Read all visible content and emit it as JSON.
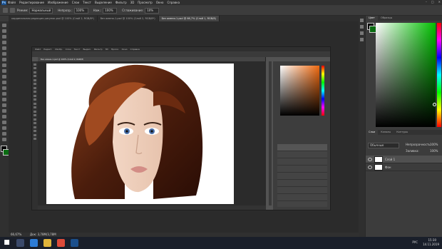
{
  "app": {
    "logo": "Ps",
    "menus": [
      "Файл",
      "Редактирование",
      "Изображение",
      "Слои",
      "Текст",
      "Выделение",
      "Фильтр",
      "3D",
      "Просмотр",
      "Окно",
      "Справка"
    ]
  },
  "options": {
    "mode_label": "Режим:",
    "mode_value": "Нормальный",
    "opacity_label": "Непрозр.:",
    "opacity_value": "100%",
    "push_label": "Наж.:",
    "push_value": "100%",
    "smooth_label": "Сглаживание:",
    "smooth_value": "10%"
  },
  "tabs": [
    {
      "label": "кардинальная редакция рисунок.psd @ 100% (Слой 2, RGB/8*)",
      "active": false
    },
    {
      "label": "без имени-1.psd @ 100% (Слой 2, RGB/8*)",
      "active": false
    },
    {
      "label": "Без имени-1.psd @ 66,7% (Слой 1, RGB/8)",
      "active": true
    }
  ],
  "nested": {
    "menus": [
      "Файл",
      "Редакт.",
      "Изобр.",
      "Слои",
      "Текст",
      "Выдел.",
      "Фильтр",
      "3D",
      "Просм.",
      "Окно",
      "Справка"
    ],
    "tab": "Без имени-1.psd @ 100% (Слой 2, RGB/8)"
  },
  "panel": {
    "tabs": [
      "Цвет",
      "Образцы"
    ],
    "layer_tabs": [
      "Слои",
      "Каналы",
      "Контуры"
    ],
    "blend": "Обычные",
    "opacity_label": "Непрозрачность:",
    "opacity": "100%",
    "fill_label": "Заливка:",
    "fill": "100%",
    "layers": [
      "Слой 1",
      "Фон"
    ]
  },
  "status": {
    "zoom": "66,67%",
    "doc": "Док: 3,78M/3,78M"
  },
  "taskbar": {
    "lang": "РУС",
    "time": "15:30",
    "date": "14.11.2019"
  },
  "colors": {
    "accent": "#1b4f8c",
    "hue": "#00c000"
  }
}
